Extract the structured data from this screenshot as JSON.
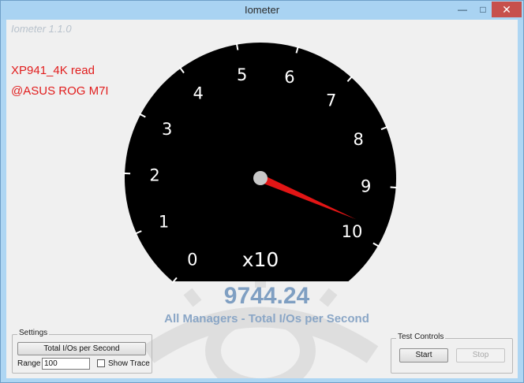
{
  "window": {
    "title": "Iometer",
    "minimize_glyph": "—",
    "maximize_glyph": "□",
    "close_glyph": "✕"
  },
  "app": {
    "version": "Iometer 1.1.0",
    "note_line1": "XP941_4K read",
    "note_line2": "@ASUS ROG M7I"
  },
  "gauge": {
    "tick_labels": [
      "0",
      "1",
      "2",
      "3",
      "4",
      "5",
      "6",
      "7",
      "8",
      "9",
      "10"
    ],
    "multiplier": "x10",
    "needle_value": 9.744,
    "dial_color": "#000000",
    "needle_color": "#e21515",
    "hub_color": "#c8c8c8"
  },
  "readout": {
    "value": "9744.24",
    "caption": "All Managers - Total I/Os per Second"
  },
  "settings": {
    "title": "Settings",
    "metric_button": "Total I/Os per Second",
    "range_label": "Range",
    "range_value": "100",
    "show_trace_label": "Show Trace",
    "show_trace_checked": false
  },
  "controls": {
    "title": "Test Controls",
    "start_label": "Start",
    "stop_label": "Stop",
    "stop_enabled": false
  }
}
